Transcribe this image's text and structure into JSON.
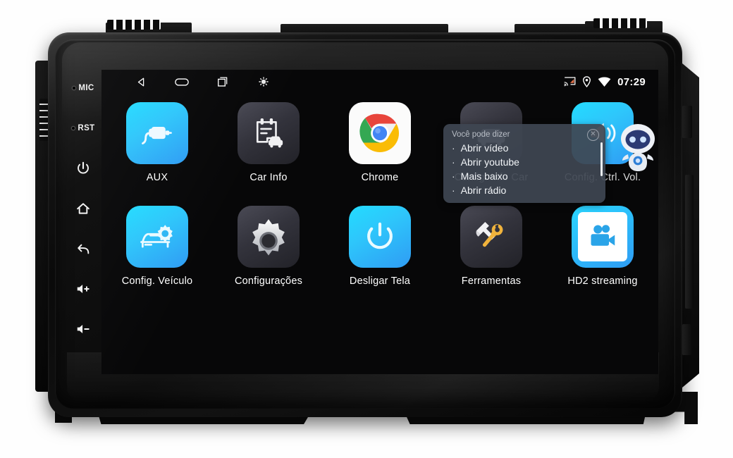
{
  "device": {
    "type": "android-car-head-unit",
    "side_keys": [
      {
        "name": "mic",
        "label": "MIC",
        "kind": "label-hole"
      },
      {
        "name": "reset",
        "label": "RST",
        "kind": "label-hole"
      },
      {
        "name": "power",
        "label": "",
        "icon": "power-icon"
      },
      {
        "name": "home",
        "label": "",
        "icon": "home-icon"
      },
      {
        "name": "back",
        "label": "",
        "icon": "back-arrow-icon"
      },
      {
        "name": "volume-up",
        "label": "",
        "icon": "volume-up-icon"
      },
      {
        "name": "volume-down",
        "label": "",
        "icon": "volume-down-icon"
      }
    ]
  },
  "statusbar": {
    "nav": [
      {
        "name": "back",
        "icon": "back-triangle-icon"
      },
      {
        "name": "home",
        "icon": "home-pill-icon"
      },
      {
        "name": "recents",
        "icon": "recents-square-icon"
      },
      {
        "name": "brightness",
        "icon": "brightness-dot-icon"
      }
    ],
    "icons": [
      {
        "name": "cast",
        "icon": "cast-icon",
        "color": "#e2714a"
      },
      {
        "name": "location",
        "icon": "location-pin-icon",
        "color": "#ffffff"
      },
      {
        "name": "wifi",
        "icon": "wifi-icon",
        "color": "#ffffff"
      }
    ],
    "time": "07:29"
  },
  "apps": {
    "row1": [
      {
        "label": "AUX",
        "icon": "aux-plug-icon",
        "style": "cyan"
      },
      {
        "label": "Car Info",
        "icon": "clipboard-car-icon",
        "style": "dark"
      },
      {
        "label": "Chrome",
        "icon": "chrome-icon",
        "style": "white"
      },
      {
        "label": "Config. Info Car",
        "icon": "car-info-settings-icon",
        "style": "dark",
        "obscured": true
      },
      {
        "label": "Config. Ctrl. Vol.",
        "icon": "volume-settings-icon",
        "style": "cyan",
        "obscured": true
      }
    ],
    "row2": [
      {
        "label": "Config. Veículo",
        "icon": "car-gear-icon",
        "style": "cyan"
      },
      {
        "label": "Configurações",
        "icon": "gear-icon",
        "style": "dark"
      },
      {
        "label": "Desligar Tela",
        "icon": "power-icon",
        "style": "cyan"
      },
      {
        "label": "Ferramentas",
        "icon": "wrench-hammer-icon",
        "style": "dark"
      },
      {
        "label": "HD2 streaming",
        "icon": "video-camera-icon",
        "style": "cyanframe"
      }
    ]
  },
  "voice_popup": {
    "title": "Você pode dizer",
    "close_icon": "close-circle-icon",
    "commands": [
      "Abrir vídeo",
      "Abrir youtube",
      "Mais baixo",
      "Abrir rádio"
    ]
  },
  "assistant": {
    "name": "robot-avatar",
    "icon": "robot-assistant-icon"
  },
  "colors": {
    "accent_cyan": "#29d4ff",
    "accent_blue": "#2f9cf4",
    "tile_dark": "#33333c",
    "popup_bg": "#3e4652",
    "cast_orange": "#e2714a"
  }
}
